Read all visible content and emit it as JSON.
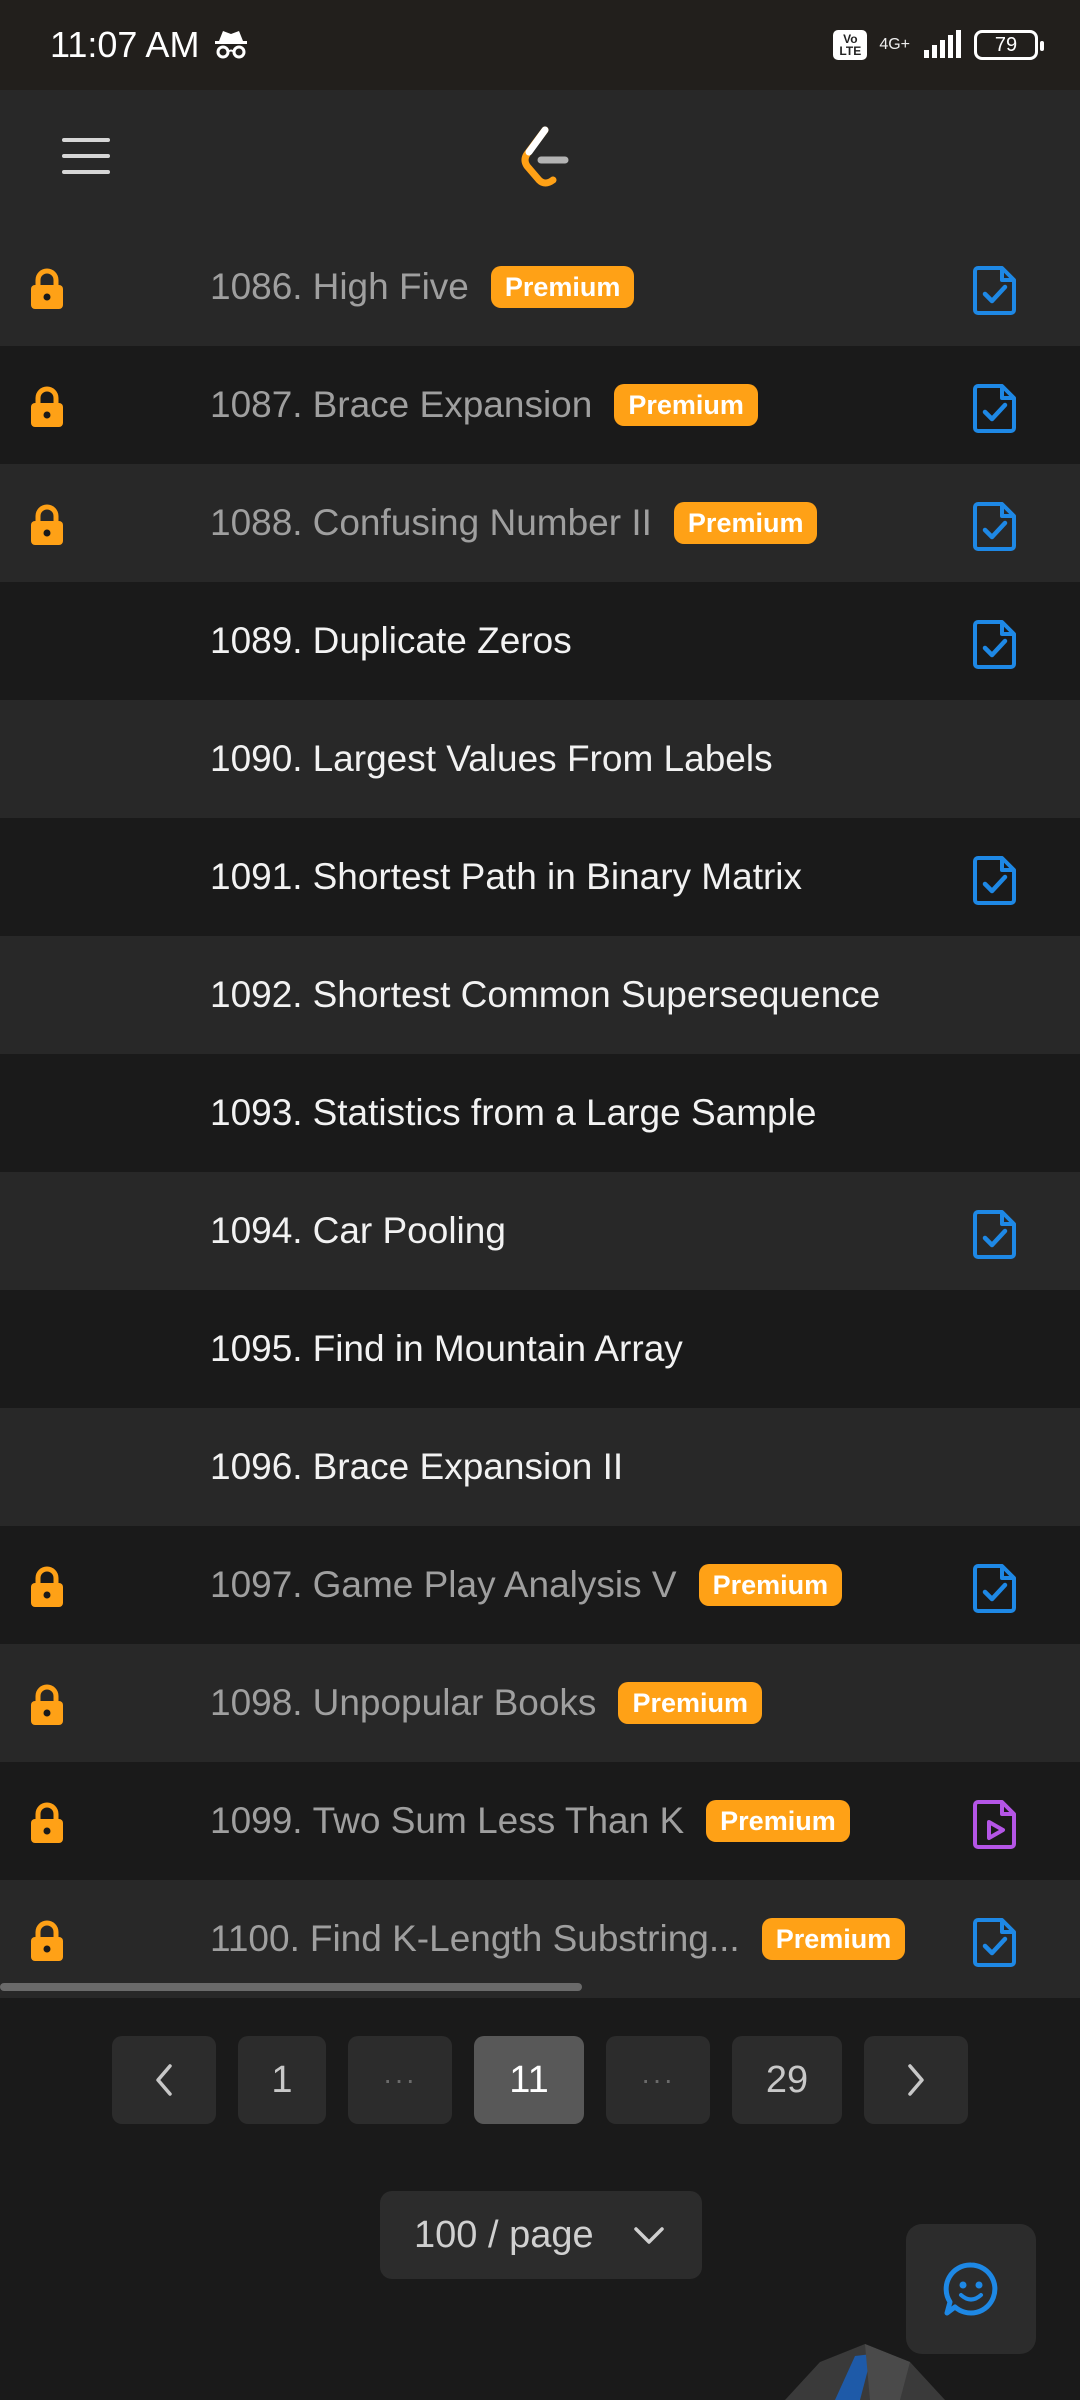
{
  "status_bar": {
    "time": "11:07 AM",
    "volte_top": "Vo",
    "volte_bottom": "LTE",
    "network": "4G+",
    "battery": "79"
  },
  "problems": [
    {
      "number": "1086.",
      "title": "High Five",
      "premium": true,
      "locked": true,
      "icon": "check-file-icon"
    },
    {
      "number": "1087.",
      "title": "Brace Expansion",
      "premium": true,
      "locked": true,
      "icon": "check-file-icon"
    },
    {
      "number": "1088.",
      "title": "Confusing Number II",
      "premium": true,
      "locked": true,
      "icon": "check-file-icon"
    },
    {
      "number": "1089.",
      "title": "Duplicate Zeros",
      "premium": false,
      "locked": false,
      "icon": "check-file-icon"
    },
    {
      "number": "1090.",
      "title": "Largest Values From Labels",
      "premium": false,
      "locked": false,
      "icon": ""
    },
    {
      "number": "1091.",
      "title": "Shortest Path in Binary Matrix",
      "premium": false,
      "locked": false,
      "icon": "check-file-icon"
    },
    {
      "number": "1092.",
      "title": "Shortest Common Supersequence",
      "premium": false,
      "locked": false,
      "icon": ""
    },
    {
      "number": "1093.",
      "title": "Statistics from a Large Sample",
      "premium": false,
      "locked": false,
      "icon": ""
    },
    {
      "number": "1094.",
      "title": "Car Pooling",
      "premium": false,
      "locked": false,
      "icon": "check-file-icon"
    },
    {
      "number": "1095.",
      "title": "Find in Mountain Array",
      "premium": false,
      "locked": false,
      "icon": ""
    },
    {
      "number": "1096.",
      "title": "Brace Expansion II",
      "premium": false,
      "locked": false,
      "icon": ""
    },
    {
      "number": "1097.",
      "title": "Game Play Analysis V",
      "premium": true,
      "locked": true,
      "icon": "check-file-icon"
    },
    {
      "number": "1098.",
      "title": "Unpopular Books",
      "premium": true,
      "locked": true,
      "icon": ""
    },
    {
      "number": "1099.",
      "title": "Two Sum Less Than K",
      "premium": true,
      "locked": true,
      "icon": "video-file-icon"
    },
    {
      "number": "1100.",
      "title": "Find K-Length Substring...",
      "premium": true,
      "locked": true,
      "icon": "check-file-icon"
    }
  ],
  "premium_label": "Premium",
  "pagination": {
    "prev": "‹",
    "first": "1",
    "ellipsis_left": "···",
    "current": "11",
    "ellipsis_right": "···",
    "last": "29",
    "next": "›"
  },
  "page_size": "100 / page",
  "colors": {
    "premium": "#ffa116",
    "lock": "#ffa116",
    "check_icon": "#1e88e5",
    "video_icon": "#b455e6",
    "feedback_icon": "#1e88e5"
  }
}
